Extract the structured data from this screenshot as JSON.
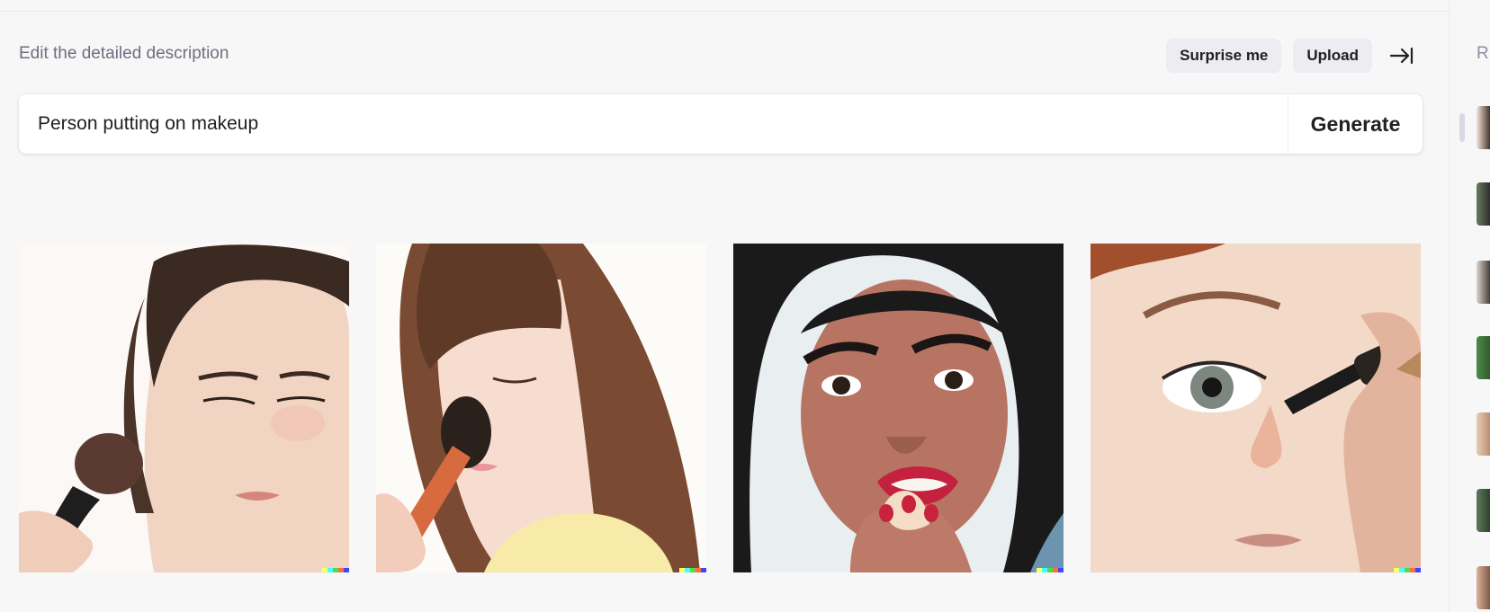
{
  "header": {
    "prompt_label": "Edit the detailed description",
    "surprise_label": "Surprise me",
    "upload_label": "Upload"
  },
  "search": {
    "value": "Person putting on makeup",
    "generate_label": "Generate"
  },
  "images": [
    {
      "alt": "Woman holding makeup brush near cheek",
      "icon": "generated-image"
    },
    {
      "alt": "Woman applying brush to nose with eyes closed",
      "icon": "generated-image"
    },
    {
      "alt": "Woman with red lips holding makeup sponge",
      "icon": "generated-image"
    },
    {
      "alt": "Close-up of eye with mascara wand",
      "icon": "generated-image"
    }
  ],
  "sidebar": {
    "title": "R",
    "history_items": 8
  },
  "colors": {
    "background": "#f7f7f8",
    "button_bg": "#ececf1",
    "text": "#202123",
    "muted": "#6e6e80",
    "badge": [
      "#ffff66",
      "#42ffff",
      "#51da4c",
      "#ff6e3c",
      "#3c46ff"
    ]
  }
}
